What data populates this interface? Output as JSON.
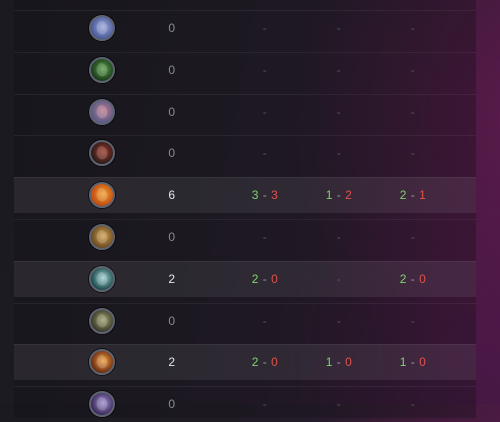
{
  "colors": {
    "win": "#7bd66a",
    "loss": "#e0524a"
  },
  "rows": [
    {
      "icon": "crossed-blades-icon",
      "icon_colors": [
        "#4a5a9a",
        "#9aa8d8"
      ],
      "total": "0",
      "a": "-",
      "b": "-",
      "c": "-"
    },
    {
      "icon": "green-beast-icon",
      "icon_colors": [
        "#1a3a1a",
        "#5aa04a"
      ],
      "total": "0",
      "a": "-",
      "b": "-",
      "c": "-"
    },
    {
      "icon": "grey-rune-icon",
      "icon_colors": [
        "#5a5a8a",
        "#c07a8a"
      ],
      "total": "0",
      "a": "-",
      "b": "-",
      "c": "-"
    },
    {
      "icon": "dark-red-icon",
      "icon_colors": [
        "#2a1a1a",
        "#a03a2a"
      ],
      "total": "0",
      "a": "-",
      "b": "-",
      "c": "-"
    },
    {
      "icon": "flaming-sword-icon",
      "icon_colors": [
        "#c04a10",
        "#f0a030"
      ],
      "total": "6",
      "a_w": "3",
      "a_l": "3",
      "b_w": "1",
      "b_l": "2",
      "c_w": "2",
      "c_l": "1",
      "highlight": true
    },
    {
      "icon": "gold-crest-icon",
      "icon_colors": [
        "#6a4a20",
        "#d0a050"
      ],
      "total": "0",
      "a": "-",
      "b": "-",
      "c": "-"
    },
    {
      "icon": "teal-gear-icon",
      "icon_colors": [
        "#1a4a4a",
        "#a0d0d0"
      ],
      "total": "2",
      "a_w": "2",
      "a_l": "0",
      "b": "-",
      "c_w": "2",
      "c_l": "0",
      "highlight": true
    },
    {
      "icon": "stone-skull-icon",
      "icon_colors": [
        "#3a3a2a",
        "#a0a070"
      ],
      "total": "0",
      "a": "-",
      "b": "-",
      "c": "-"
    },
    {
      "icon": "orange-spike-icon",
      "icon_colors": [
        "#6a2a10",
        "#f0a040"
      ],
      "total": "2",
      "a_w": "2",
      "a_l": "0",
      "b_w": "1",
      "b_l": "0",
      "c_w": "1",
      "c_l": "0",
      "highlight": true
    },
    {
      "icon": "violet-orb-icon",
      "icon_colors": [
        "#3a2a5a",
        "#a090d0"
      ],
      "total": "0",
      "a": "-",
      "b": "-",
      "c": "-"
    }
  ]
}
